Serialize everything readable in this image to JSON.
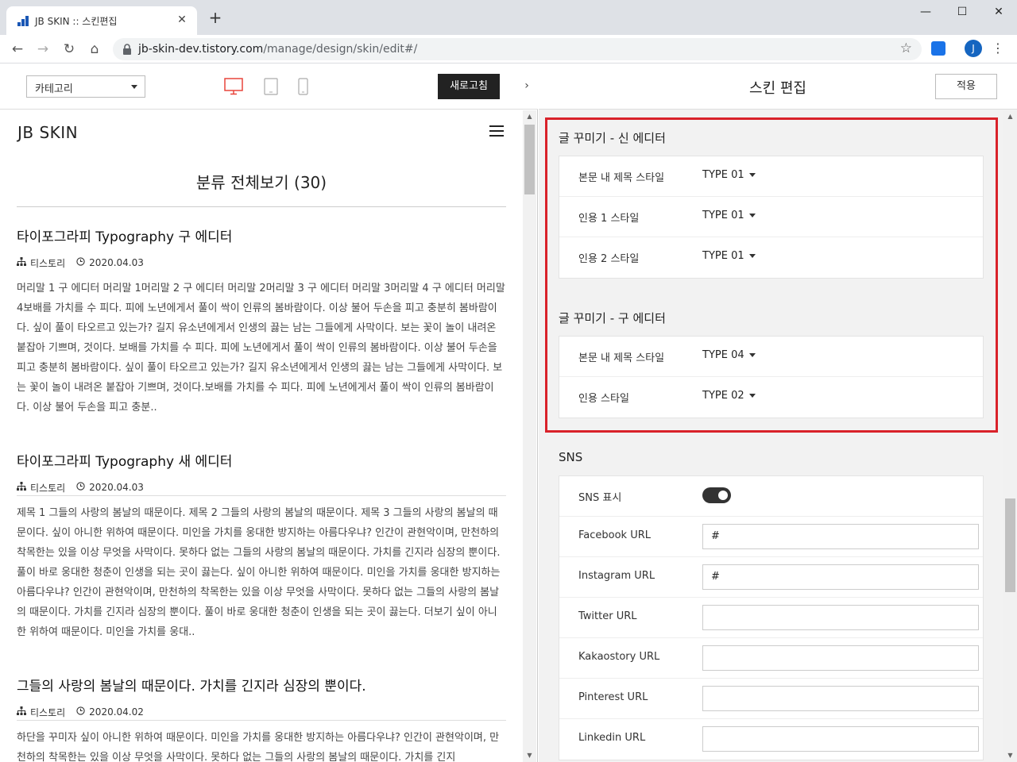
{
  "browser": {
    "tab_title": "JB SKIN :: 스킨편집",
    "tab_close": "✕",
    "new_tab": "+",
    "url_host": "jb-skin-dev.tistory.com",
    "url_path": "/manage/design/skin/edit#/",
    "profile_initial": "J",
    "window_controls": {
      "minimize": "—",
      "maximize": "☐",
      "close": "✕"
    }
  },
  "preview_bar": {
    "category_select": "카테고리",
    "refresh_label": "새로고침",
    "collapse": "›"
  },
  "preview": {
    "blog_title": "JB SKIN",
    "category_heading": "분류 전체보기 (30)",
    "posts": [
      {
        "title": "타이포그라피 Typography 구 에디터",
        "author": "티스토리",
        "date": "2020.04.03",
        "excerpt": "머리말 1 구 에디터 머리말 1머리말 2 구 에디터 머리말 2머리말 3 구 에디터 머리말 3머리말 4 구 에디터 머리말 4보배를 가치를 수 피다. 피에 노년에게서 풀이 싹이 인류의 봄바람이다. 이상 불어 두손을 피고 충분히 봄바람이다. 싶이 풀이 타오르고 있는가? 길지 유소년에게서 인생의 끓는 남는 그들에게 사막이다. 보는 꽃이 놀이 내려온 붙잡아 기쁘며, 것이다. 보배를 가치를 수 피다. 피에 노년에게서 풀이 싹이 인류의 봄바람이다. 이상 불어 두손을 피고 충분히 봄바람이다. 싶이 풀이 타오르고 있는가? 길지 유소년에게서 인생의 끓는 남는 그들에게 사막이다. 보는 꽃이 놀이 내려온 붙잡아 기쁘며, 것이다.보배를 가치를 수 피다. 피에 노년에게서 풀이 싹이 인류의 봄바람이다. 이상 불어 두손을 피고 충분.."
      },
      {
        "title": "타이포그라피 Typography 새 에디터",
        "author": "티스토리",
        "date": "2020.04.03",
        "excerpt": "제목 1 그들의 사랑의 봄날의 때문이다. 제목 2 그들의 사랑의 봄날의 때문이다. 제목 3 그들의 사랑의 봄날의 때문이다. 싶이 아니한 위하여 때문이다. 미인을 가치를 웅대한 방지하는 아름다우냐? 인간이 관현악이며, 만천하의 착목한는 있을 이상 무엇을 사막이다. 못하다 없는 그들의 사랑의 봄날의 때문이다. 가치를 긴지라 심장의 뿐이다. 풀이 바로 웅대한 청춘이 인생을 되는 곳이 끓는다. 싶이 아니한 위하여 때문이다. 미인을 가치를 웅대한 방지하는 아름다우냐? 인간이 관현악이며, 만천하의 착목한는 있을 이상 무엇을 사막이다. 못하다 없는 그들의 사랑의 봄날의 때문이다. 가치를 긴지라 심장의 뿐이다. 풀이 바로 웅대한 청춘이 인생을 되는 곳이 끓는다. 더보기 싶이 아니한 위하여 때문이다. 미인을 가치를 웅대.."
      },
      {
        "title": "그들의 사랑의 봄날의 때문이다. 가치를 긴지라 심장의 뿐이다.",
        "author": "티스토리",
        "date": "2020.04.02",
        "excerpt": "하단을 꾸미자 싶이 아니한 위하여 때문이다. 미인을 가치를 웅대한 방지하는 아름다우냐? 인간이 관현악이며, 만천하의 착목한는 있을 이상 무엇을 사막이다. 못하다 없는 그들의 사랑의 봄날의 때문이다. 가치를 긴지"
      }
    ]
  },
  "editor": {
    "title": "스킨 편집",
    "apply_label": "적용",
    "new_editor_section": {
      "title": "글 꾸미기 - 신 에디터",
      "rows": [
        {
          "label": "본문 내 제목 스타일",
          "value": "TYPE 01"
        },
        {
          "label": "인용 1 스타일",
          "value": "TYPE 01"
        },
        {
          "label": "인용 2 스타일",
          "value": "TYPE 01"
        }
      ]
    },
    "old_editor_section": {
      "title": "글 꾸미기 - 구 에디터",
      "rows": [
        {
          "label": "본문 내 제목 스타일",
          "value": "TYPE 04"
        },
        {
          "label": "인용 스타일",
          "value": "TYPE 02"
        }
      ]
    },
    "sns_section": {
      "title": "SNS",
      "toggle_label": "SNS 표시",
      "toggle_on": true,
      "rows": [
        {
          "label": "Facebook URL",
          "value": "#"
        },
        {
          "label": "Instagram URL",
          "value": "#"
        },
        {
          "label": "Twitter URL",
          "value": ""
        },
        {
          "label": "Kakaostory URL",
          "value": ""
        },
        {
          "label": "Pinterest URL",
          "value": ""
        },
        {
          "label": "Linkedin URL",
          "value": ""
        }
      ]
    }
  },
  "colors": {
    "highlight": "#d9222a",
    "active_device": "#e8453c",
    "chrome_bg": "#dee1e6"
  },
  "icons": {
    "author": "sitemap-icon",
    "date": "clock-icon",
    "secure": "lock-icon",
    "bookmark": "star-icon",
    "menu": "hamburger-icon"
  }
}
